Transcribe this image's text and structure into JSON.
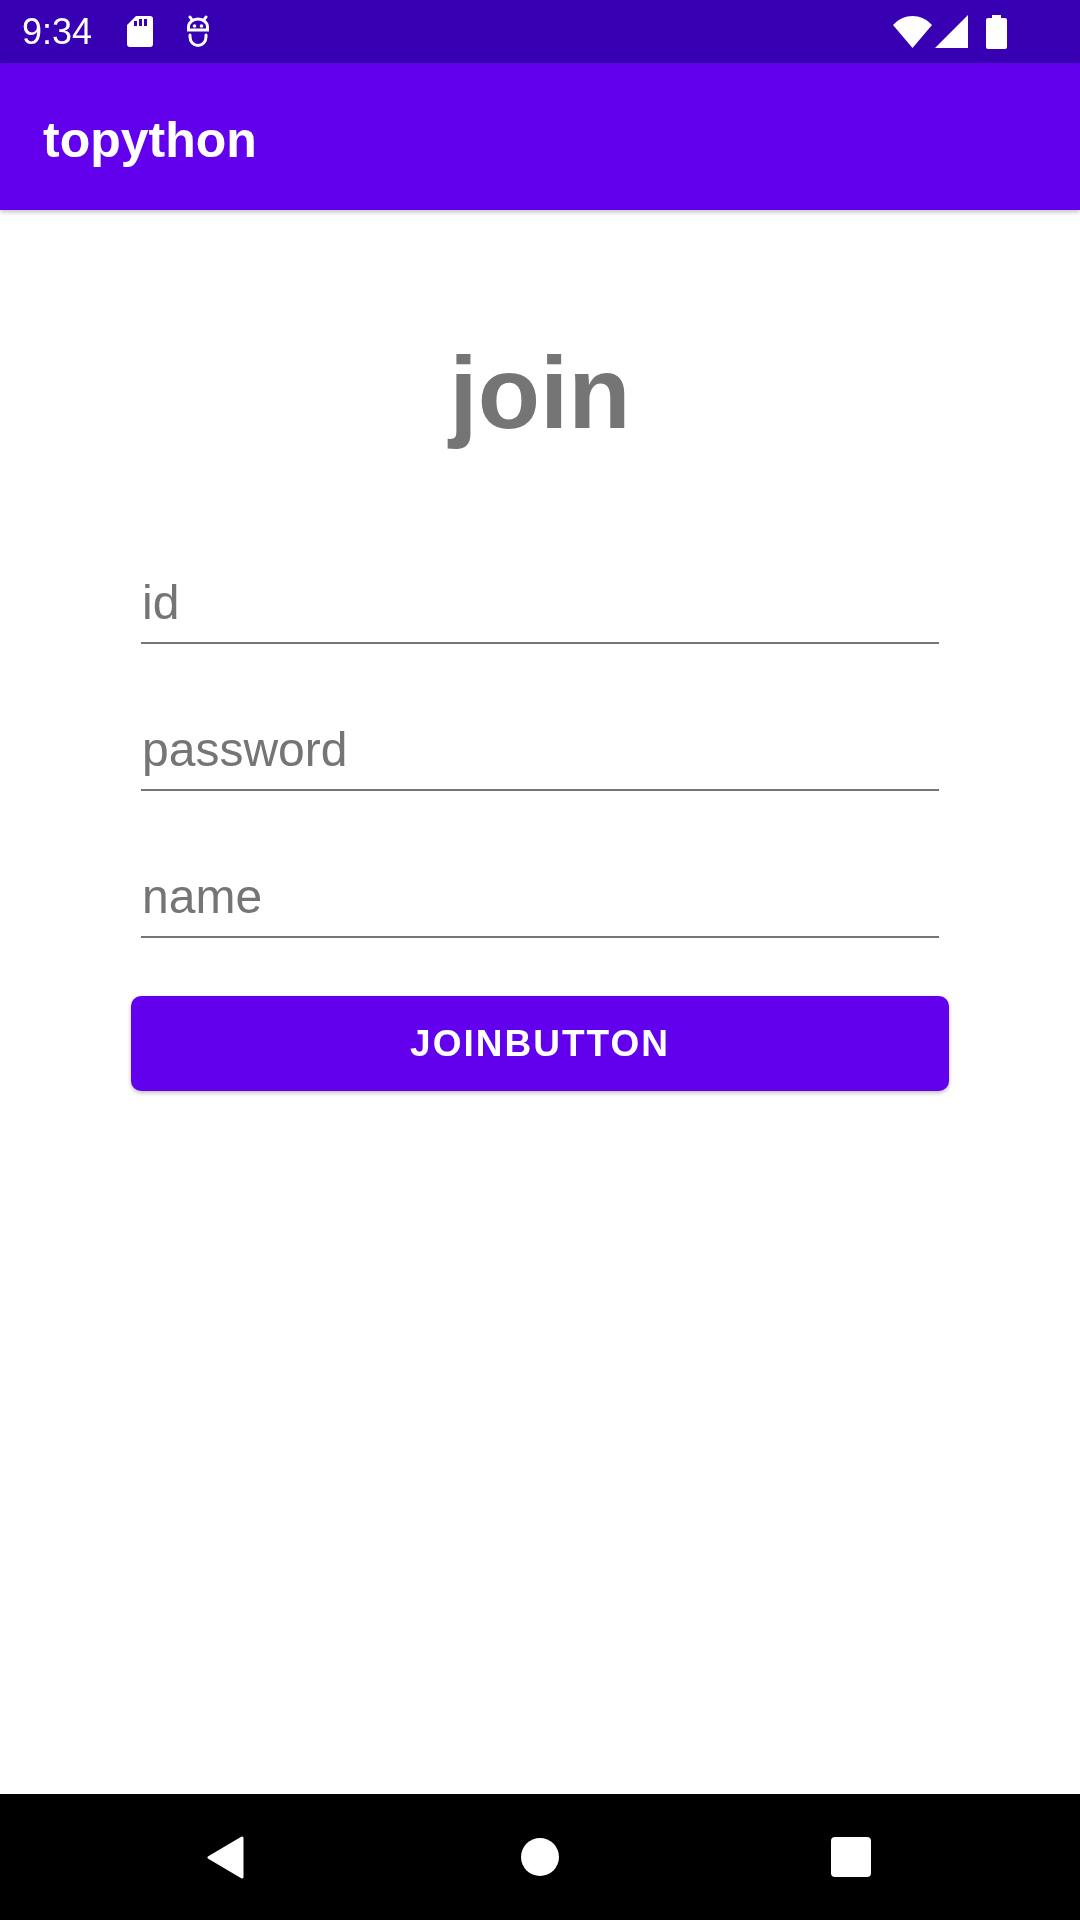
{
  "status_bar": {
    "time": "9:34"
  },
  "app_bar": {
    "title": "topython"
  },
  "heading": "join",
  "fields": [
    {
      "placeholder": "id"
    },
    {
      "placeholder": "password"
    },
    {
      "placeholder": "name"
    }
  ],
  "button": {
    "label": "JOINBUTTON"
  }
}
